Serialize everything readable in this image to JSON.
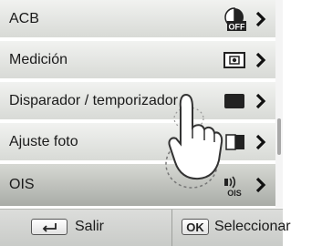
{
  "menu": {
    "items": [
      {
        "label": "ACB",
        "icon": "acb-off-icon"
      },
      {
        "label": "Medición",
        "icon": "metering-icon"
      },
      {
        "label": "Disparador / temporizador",
        "icon": "drive-single-icon"
      },
      {
        "label": "Ajuste foto",
        "icon": "photo-adjust-icon"
      },
      {
        "label": "OIS",
        "icon": "ois-icon",
        "selected": true
      }
    ],
    "acb_icon_text": "OFF",
    "ois_icon_text": "OIS"
  },
  "bottom_bar": {
    "exit_label": "Salir",
    "ok_key": "OK",
    "select_label": "Seleccionar"
  },
  "colors": {
    "item_bg": "#e4e6e2",
    "selected_bg": "#b8bbb6",
    "text": "#1a1a1a"
  }
}
